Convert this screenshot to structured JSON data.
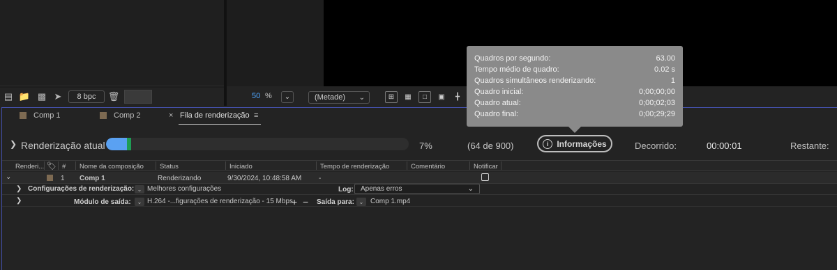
{
  "project_toolbar": {
    "bpc_label": "8 bpc"
  },
  "viewer_toolbar": {
    "zoom_value": "50",
    "zoom_unit": "%",
    "resolution": "(Metade)"
  },
  "tabs": [
    {
      "label": "Comp 1",
      "swatch": "#7d6a52"
    },
    {
      "label": "Comp 2",
      "swatch": "#7d6a52"
    },
    {
      "label": "Fila de renderização",
      "close": "×",
      "menu": "≡"
    }
  ],
  "current_render": {
    "label": "Renderização atual",
    "progress_percent": 7,
    "percent_text": "7%",
    "frames_text": "(64 de 900)",
    "info_button": "Informações",
    "elapsed_label": "Decorrido:",
    "elapsed_value": "00:00:01",
    "remaining_label": "Restante:"
  },
  "tooltip": {
    "rows": [
      {
        "label": "Quadros por segundo:",
        "value": "63.00"
      },
      {
        "label": "Tempo médio de quadro:",
        "value": "0.02 s"
      },
      {
        "label": "Quadros simultâneos renderizando:",
        "value": "1"
      },
      {
        "label": "Quadro inicial:",
        "value": "0;00;00;00"
      },
      {
        "label": "Quadro atual:",
        "value": "0;00;02;03"
      },
      {
        "label": "Quadro final:",
        "value": "0;00;29;29"
      }
    ]
  },
  "columns": {
    "render": "Renderi...",
    "number": "#",
    "comp_name": "Nome da composição",
    "status": "Status",
    "started": "Iniciado",
    "render_time": "Tempo de renderização",
    "comment": "Comentário",
    "notify": "Notificar"
  },
  "queue_item": {
    "number": "1",
    "comp_name": "Comp 1",
    "status": "Renderizando",
    "started": "9/30/2024, 10:48:58 AM",
    "render_time": "-",
    "render_settings_label": "Configurações de renderização:",
    "render_settings_value": "Melhores configurações",
    "log_label": "Log:",
    "log_value": "Apenas erros",
    "output_module_label": "Módulo de saída:",
    "output_module_value": "H.264 -...figurações de renderização - 15 Mbps",
    "output_to_label": "Saída para:",
    "output_to_value": "Comp 1.mp4"
  }
}
